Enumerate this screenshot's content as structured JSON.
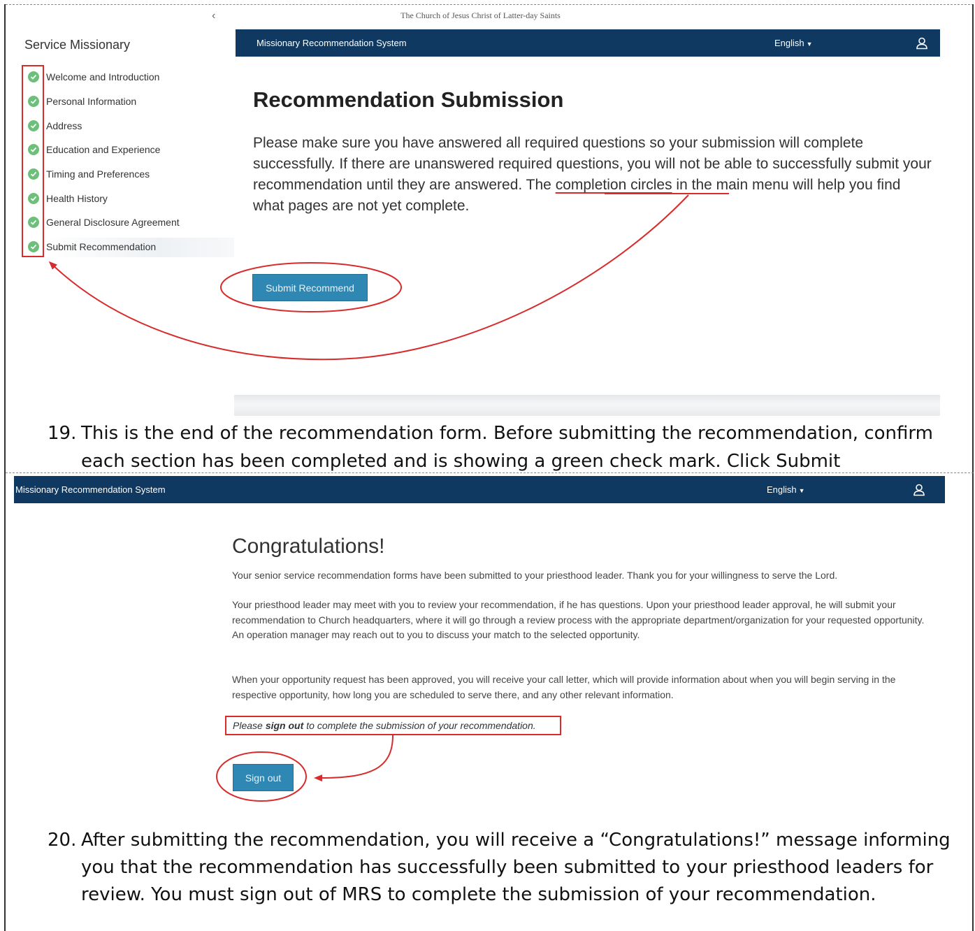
{
  "panel1": {
    "church_name": "The Church of Jesus Christ of Latter-day Saints",
    "sidebar": {
      "title": "Service Missionary",
      "collapse_icon": "‹",
      "items": [
        {
          "label": "Welcome and Introduction",
          "status": "complete"
        },
        {
          "label": "Personal Information",
          "status": "complete"
        },
        {
          "label": "Address",
          "status": "complete"
        },
        {
          "label": "Education and Experience",
          "status": "complete"
        },
        {
          "label": "Timing and Preferences",
          "status": "complete"
        },
        {
          "label": "Health History",
          "status": "complete"
        },
        {
          "label": "General Disclosure Agreement",
          "status": "complete"
        },
        {
          "label": "Submit Recommendation",
          "status": "complete"
        }
      ]
    },
    "appbar": {
      "title": "Missionary Recommendation System",
      "language": "English",
      "user_icon": "user-icon"
    },
    "heading": "Recommendation Submission",
    "body_before": "Please make sure you have answered all required questions so your submission will complete successfully. If there are unanswered required questions, you will not be able to successfully submit your recommendation until they are answered. The ",
    "body_link": "completion circles",
    "body_after": " in the main menu will help you find what pages are not yet complete.",
    "submit_button": "Submit Recommend"
  },
  "caption1": {
    "number": "19.",
    "line1": "This is the end of the recommendation form.  Before submitting the recommendation, confirm",
    "line2": "each section has been completed and is showing a green check mark. Click Submit Recommend."
  },
  "panel2": {
    "appbar": {
      "title": "Missionary Recommendation System",
      "language": "English",
      "user_icon": "user-icon"
    },
    "title": "Congratulations!",
    "p1": "Your senior service recommendation forms have been submitted to your priesthood leader. Thank you for your willingness to serve the Lord.",
    "p2": "Your priesthood leader may meet with you to review your recommendation, if he has questions. Upon your priesthood leader approval, he will submit your recommendation to Church headquarters, where it will go through a review process with the appropriate department/organization for your requested opportunity. An operation manager may reach out to you to discuss your match to the selected opportunity.",
    "p3": "When your opportunity request has been approved, you will receive your call letter, which will provide information about when you will begin serving in the respective opportunity, how long you are scheduled to serve there, and any other relevant information.",
    "note_before": "Please",
    "note_bold": "sign out",
    "note_after": "to complete the submission of your recommendation.",
    "signout_button": "Sign out"
  },
  "caption2": {
    "number": "20.",
    "line1": "After submitting the recommendation, you will receive a “Congratulations!” message informing",
    "line2": "you that the recommendation has successfully been submitted to your priesthood leaders for",
    "line3": "review.  You must sign out of MRS to complete the submission of your recommendation."
  },
  "colors": {
    "appbar": "#0f3961",
    "button": "#2f88b4",
    "check": "#6cc07a",
    "annotation": "#d82b2b"
  }
}
